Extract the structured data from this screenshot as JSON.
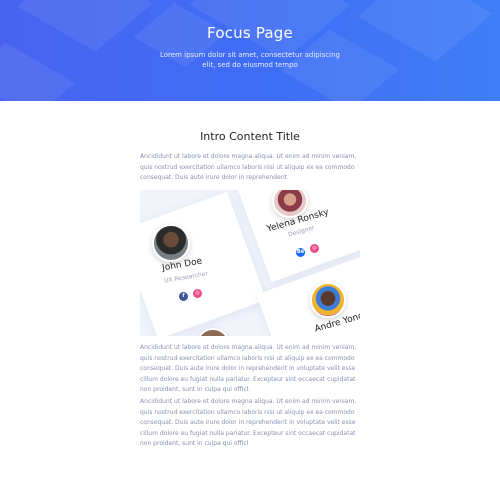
{
  "hero": {
    "title": "Focus Page",
    "subtitle": "Lorem ipsum dolor sit amet, consectetur adipiscing elit, sed do eiusmod tempo"
  },
  "content": {
    "title": "Intro Content Title",
    "paragraph_1": "Ancididunt ut labore et dolore magna aliqua. Ut enim ad minim veniam, quis nostrud exercitation ullamco laboris nisi ut aliquip ex ea commodo consequat. Duis aute irure dolor in reprehenderit",
    "paragraph_2": "Ancididunt ut labore et dolore magna aliqua. Ut enim ad minim veniam, quis nostrud exercitation ullamco laboris nisi ut aliquip ex ea commodo consequat. Duis aute irure dolor in reprehenderit in voluptate velit esse cillum dolore eu fugiat nulla pariatur. Excepteur sint occaecat cupidatat non proident, sunt in culpa qui officl.",
    "paragraph_3": "Ancididunt ut labore et dolore magna aliqua. Ut enim ad minim veniam, quis nostrud exercitation ullamco laboris nisi ut aliquip ex ea commodo consequat. Duis aute irure dolor in reprehenderit in voluptate velit esse cillum dolore eu fugiat nulla pariatur. Excepteur sint occaecat cupidatat non proident, sunt in culpa qui officl"
  },
  "team_cards": [
    {
      "name": "John Doe",
      "role": "UX Researcher",
      "socials": [
        "facebook-icon",
        "dribbble-icon"
      ]
    },
    {
      "name": "Yelena Ronsky",
      "role": "Designer",
      "socials": [
        "behance-icon",
        "dribbble-icon"
      ]
    },
    {
      "name": "Andre Yonc",
      "role": "",
      "socials": []
    }
  ],
  "colors": {
    "hero_gradient_start": "#4764f0",
    "hero_gradient_end": "#3f7ef7",
    "facebook": "#3b5998",
    "behance": "#1769ff",
    "dribbble": "#ea4c89",
    "body_text": "#8a90b0"
  }
}
